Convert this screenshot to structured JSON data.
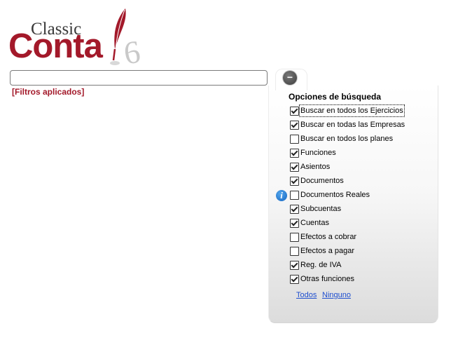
{
  "logo": {
    "top_text": "Classic",
    "main_text": "Conta",
    "version": "6",
    "colors": {
      "brand": "#a3192a",
      "top_text": "#3a3a3a",
      "version": "#c9c9c9"
    }
  },
  "search": {
    "value": "",
    "placeholder": ""
  },
  "filters_applied_label": "[Filtros aplicados]",
  "panel": {
    "toggle_symbol": "−",
    "title": "Opciones de búsqueda",
    "options": [
      {
        "label": "Buscar en todos los Ejercicios",
        "checked": true
      },
      {
        "label": "Buscar en todas las Empresas",
        "checked": true
      },
      {
        "label": "Buscar en todos los planes",
        "checked": false
      },
      {
        "label": "Funciones",
        "checked": true
      },
      {
        "label": "Asientos",
        "checked": true
      },
      {
        "label": "Documentos",
        "checked": true
      },
      {
        "label": "Documentos Reales",
        "checked": false
      },
      {
        "label": "Subcuentas",
        "checked": true
      },
      {
        "label": "Cuentas",
        "checked": true
      },
      {
        "label": "Efectos a cobrar",
        "checked": false
      },
      {
        "label": "Efectos a pagar",
        "checked": false
      },
      {
        "label": "Reg. de IVA",
        "checked": true
      },
      {
        "label": "Otras funciones",
        "checked": true
      }
    ],
    "info_symbol": "i",
    "select_all_label": "Todos",
    "select_none_label": "Ninguno",
    "link_color": "#1f4fcf"
  }
}
